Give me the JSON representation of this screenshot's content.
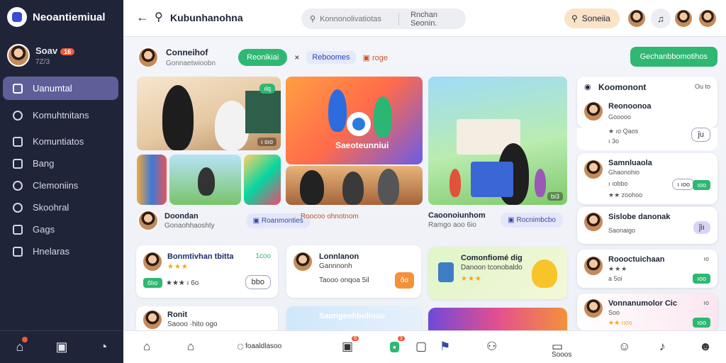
{
  "app": {
    "name": "Neoantiemiual"
  },
  "profile": {
    "name": "Soav",
    "badge": "16",
    "sub": "7Z/3"
  },
  "sidebar": {
    "items": [
      {
        "label": "Uanumtal",
        "icon": "document-icon",
        "active": true
      },
      {
        "label": "Komuhtnitans",
        "icon": "chat-icon"
      },
      {
        "label": "Komuntiatos",
        "icon": "list-icon"
      },
      {
        "label": "Bang",
        "icon": "bag-icon"
      },
      {
        "label": "Clemoniins",
        "icon": "heart-icon"
      },
      {
        "label": "Skoohral",
        "icon": "info-icon"
      },
      {
        "label": "Gags",
        "icon": "thumb-icon"
      },
      {
        "label": "Hnelaras",
        "icon": "grid-icon"
      }
    ],
    "bottom_icons": [
      "home-icon",
      "gallery-icon",
      "profile-icon"
    ]
  },
  "topbar": {
    "back": "←",
    "title": "Kubunhanohna",
    "search_placeholder": "Konnonolivatiotas",
    "search_tab": "Rnchan Seonin.",
    "search_pill": "Soneiia"
  },
  "feed": {
    "author": {
      "name": "Conneihof",
      "sub": "Gonnaetwioobn"
    },
    "follow_label": "Reonikiai",
    "tag_label": "Reboomes",
    "tag2_label": "roge",
    "top_action": "Gechanbbomotihos",
    "media1": {
      "badge": "ılq",
      "label": "ı sıo"
    },
    "media2": {
      "overlay": "Saeoteunniui"
    },
    "media3": {
      "label": "bi3"
    },
    "captions": [
      {
        "title": "Doondan",
        "sub": "Gonaohhaoshty",
        "button": "Roanmonties"
      },
      {
        "title": "",
        "sub": "Roocoo ohnotnom",
        "button": ""
      },
      {
        "title": "Caoonoiunhom",
        "sub": "Ramgo aoo 6io",
        "button": "Rocnimbcbo"
      }
    ],
    "cards": [
      {
        "title": "Bonmtivhan tbitta",
        "sub": "★★★",
        "aside": "1coo",
        "btn": "bbo",
        "rating": "★★★ ı 6o",
        "pill": "ôlıo"
      },
      {
        "title": "Lonnlanon",
        "sub": "Gannnonh",
        "line": "Taooo onqoa 5il",
        "btn": "ôo"
      },
      {
        "title": "Comonfiomé dig",
        "sub": "Danoon tconobaldo",
        "stars": "★★★"
      },
      {
        "title": "Ronit",
        "sub": "Saooo ·hito ogo"
      },
      {
        "title": "Saongeohbolinuo",
        "sub": ""
      }
    ]
  },
  "right_panel": {
    "header": {
      "title": "Koomonont",
      "count": "Ou to"
    },
    "items": [
      {
        "title": "Reonoonoa",
        "sub1": "Gooooo",
        "sub2": "★ ıo Qaos",
        "count": "ı 3o",
        "btn": "ĵu",
        "rating": "★★★"
      },
      {
        "title": "Samnluaola",
        "sub1": "Ghaonohio",
        "sub2": "★★ zoohoo",
        "count": "ı ıobbo",
        "btn": "ıoo"
      },
      {
        "title": "Sislobe danonak",
        "sub1": "Saonaigo",
        "btn": "ĵiı"
      },
      {
        "title": "Roooctuichaan",
        "sub1": "★★★",
        "count": "a 5oi",
        "btn": "ıoo",
        "sub2": "ıo"
      },
      {
        "title": "Vonnanumolor Cic",
        "sub1": "Soo",
        "count": "★★ ııoo",
        "btn": "ıoo",
        "sub2": "ıo"
      }
    ]
  },
  "bottombar": {
    "items": [
      {
        "icon": "home-icon",
        "label": ""
      },
      {
        "icon": "house-icon",
        "label": ""
      },
      {
        "icon": "chat-icon",
        "label": "foaaldlasoo"
      },
      {
        "icon": "camera-icon",
        "label": "",
        "badge": "6"
      },
      {
        "icon": "chat-green-icon",
        "label": "",
        "badge": "3"
      },
      {
        "icon": "chat-icon-2",
        "label": ""
      },
      {
        "icon": "flag-icon",
        "label": ""
      },
      {
        "icon": "people-icon",
        "label": ""
      },
      {
        "icon": "message-icon",
        "label": "Sooos"
      },
      {
        "icon": "group-icon",
        "label": ""
      },
      {
        "icon": "bell-icon",
        "label": ""
      },
      {
        "icon": "smile-icon",
        "label": ""
      }
    ]
  },
  "colors": {
    "sidebar": "#1f2438",
    "accent_green": "#2eb872",
    "active_nav": "#5e5f99",
    "orange": "#f3923a"
  }
}
